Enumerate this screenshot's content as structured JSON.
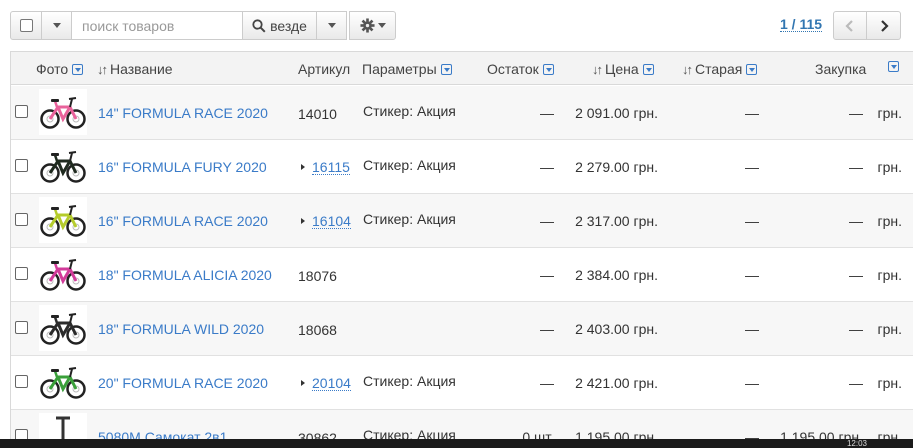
{
  "toolbar": {
    "search_placeholder": "поиск товаров",
    "where_label": "везде"
  },
  "pager": {
    "text": "1 / 115"
  },
  "columns": {
    "photo": "Фото",
    "name": "Название",
    "sku": "Артикул",
    "params": "Параметры",
    "stock": "Остаток",
    "price": "Цена",
    "old_price": "Старая",
    "purchase": "Закупка"
  },
  "rows": [
    {
      "name": "14\" FORMULA RACE 2020",
      "sku": "14010",
      "has_variants": false,
      "params": "Стикер: Акция",
      "stock": "—",
      "price": "2 091.00 грн.",
      "old": "—",
      "purchase": "—",
      "currency": "грн.",
      "bike_color": "#e9629b"
    },
    {
      "name": "16\" FORMULA FURY 2020",
      "sku": "16115",
      "has_variants": true,
      "params": "Стикер: Акция",
      "stock": "—",
      "price": "2 279.00 грн.",
      "old": "—",
      "purchase": "—",
      "currency": "грн.",
      "bike_color": "#1f2a1f"
    },
    {
      "name": "16\" FORMULA RACE 2020",
      "sku": "16104",
      "has_variants": true,
      "params": "Стикер: Акция",
      "stock": "—",
      "price": "2 317.00 грн.",
      "old": "—",
      "purchase": "—",
      "currency": "грн.",
      "bike_color": "#b5cc2b"
    },
    {
      "name": "18\" FORMULA ALICIA 2020",
      "sku": "18076",
      "has_variants": false,
      "params": "",
      "stock": "—",
      "price": "2 384.00 грн.",
      "old": "—",
      "purchase": "—",
      "currency": "грн.",
      "bike_color": "#d23b9a"
    },
    {
      "name": "18\" FORMULA WILD 2020",
      "sku": "18068",
      "has_variants": false,
      "params": "",
      "stock": "—",
      "price": "2 403.00 грн.",
      "old": "—",
      "purchase": "—",
      "currency": "грн.",
      "bike_color": "#2b2b2b"
    },
    {
      "name": "20\" FORMULA RACE 2020",
      "sku": "20104",
      "has_variants": true,
      "params": "Стикер: Акция",
      "stock": "—",
      "price": "2 421.00 грн.",
      "old": "—",
      "purchase": "—",
      "currency": "грн.",
      "bike_color": "#3aa03a"
    },
    {
      "name": "5080M Самокат 2в1",
      "sku": "30862",
      "has_variants": false,
      "params": "Стикер: Акция",
      "stock": "0 шт.",
      "price": "1 195.00 грн.",
      "old": "—",
      "purchase": "1 195.00 грн.",
      "currency": "грн.",
      "bike_color": "#333333"
    }
  ],
  "taskbar": {
    "clock": "12:03"
  },
  "colors": {
    "link": "#3a7bc8",
    "header_bg": "#f3f3f3",
    "row_alt": "#f7f7f7"
  }
}
